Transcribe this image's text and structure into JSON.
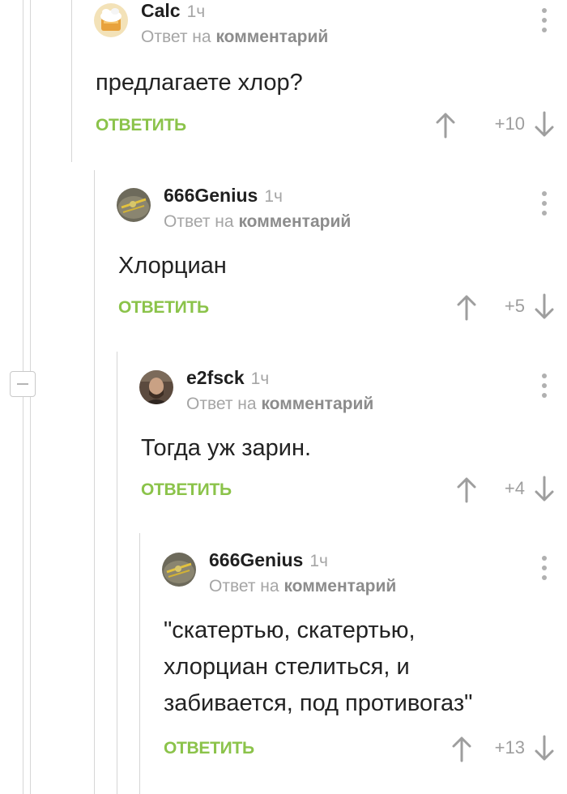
{
  "collapse_toggle_icon": "minus-square-icon",
  "colors": {
    "accent": "#8bc34a",
    "muted": "#a5a5a5",
    "thread_line": "#d6d6d6"
  },
  "comments": [
    {
      "author": "Calc",
      "time": "1ч",
      "reply_prefix": "Ответ на",
      "reply_target": "комментарий",
      "text": "предлагаете хлор?",
      "reply_label": "ОТВЕТИТЬ",
      "score": "+10",
      "avatar_icon": "cupcake-avatar-icon"
    },
    {
      "author": "666Genius",
      "time": "1ч",
      "reply_prefix": "Ответ на",
      "reply_target": "комментарий",
      "text": "Хлорциан",
      "reply_label": "ОТВЕТИТЬ",
      "score": "+5",
      "avatar_icon": "helmet-avatar-icon"
    },
    {
      "author": "e2fsck",
      "time": "1ч",
      "reply_prefix": "Ответ на",
      "reply_target": "комментарий",
      "text": "Тогда уж зарин.",
      "reply_label": "ОТВЕТИТЬ",
      "score": "+4",
      "avatar_icon": "person-photo-avatar-icon"
    },
    {
      "author": "666Genius",
      "time": "1ч",
      "reply_prefix": "Ответ на",
      "reply_target": "комментарий",
      "text": "\"скатертью, скатертью,\nхлорциан стелиться, и\nзабивается, под противогаз\"",
      "reply_label": "ОТВЕТИТЬ",
      "score": "+13",
      "avatar_icon": "helmet-avatar-icon"
    }
  ]
}
